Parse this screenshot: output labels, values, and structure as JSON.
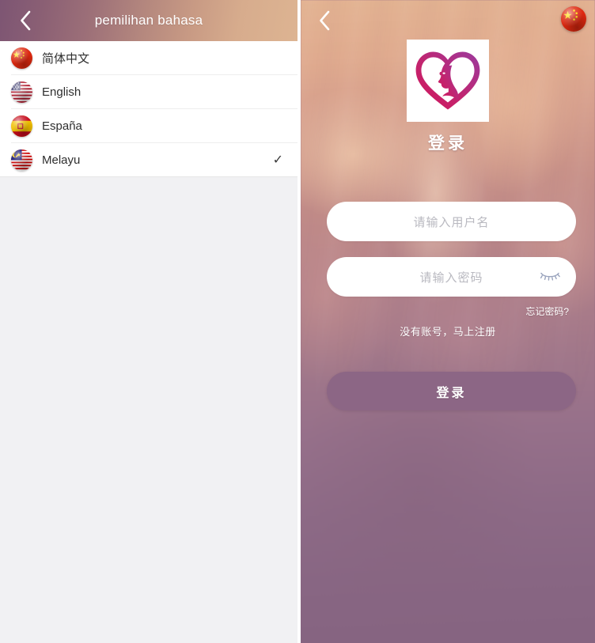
{
  "language_panel": {
    "header": {
      "title": "pemilihan bahasa",
      "back_icon": "chevron-left-icon"
    },
    "items": [
      {
        "label": "简体中文",
        "flag": "flag-china",
        "selected": false,
        "check": "✓"
      },
      {
        "label": "English",
        "flag": "flag-usa",
        "selected": false,
        "check": "✓"
      },
      {
        "label": "España",
        "flag": "flag-spain",
        "selected": false,
        "check": "✓"
      },
      {
        "label": "Melayu",
        "flag": "flag-malaysia",
        "selected": true,
        "check": "✓"
      }
    ]
  },
  "login_panel": {
    "back_icon": "chevron-left-icon",
    "flag_badge": "flag-china",
    "logo": "heart-woman-logo",
    "heading": "登录",
    "username": {
      "placeholder": "请输入用户名",
      "value": ""
    },
    "password": {
      "placeholder": "请输入密码",
      "value": "",
      "toggle_icon": "eye-closed-icon"
    },
    "forgot_password": "忘记密码?",
    "register_prompt": "没有账号，马上注册",
    "submit_label": "登录"
  },
  "colors": {
    "header_gradient_start": "#7d5573",
    "header_gradient_end": "#ddb492",
    "login_button": "#8c6685",
    "logo_magenta": "#c2256f",
    "logo_purple": "#9b3a9e",
    "placeholder_text": "#b9b9c0",
    "panel_background": "#f1f1f3"
  }
}
